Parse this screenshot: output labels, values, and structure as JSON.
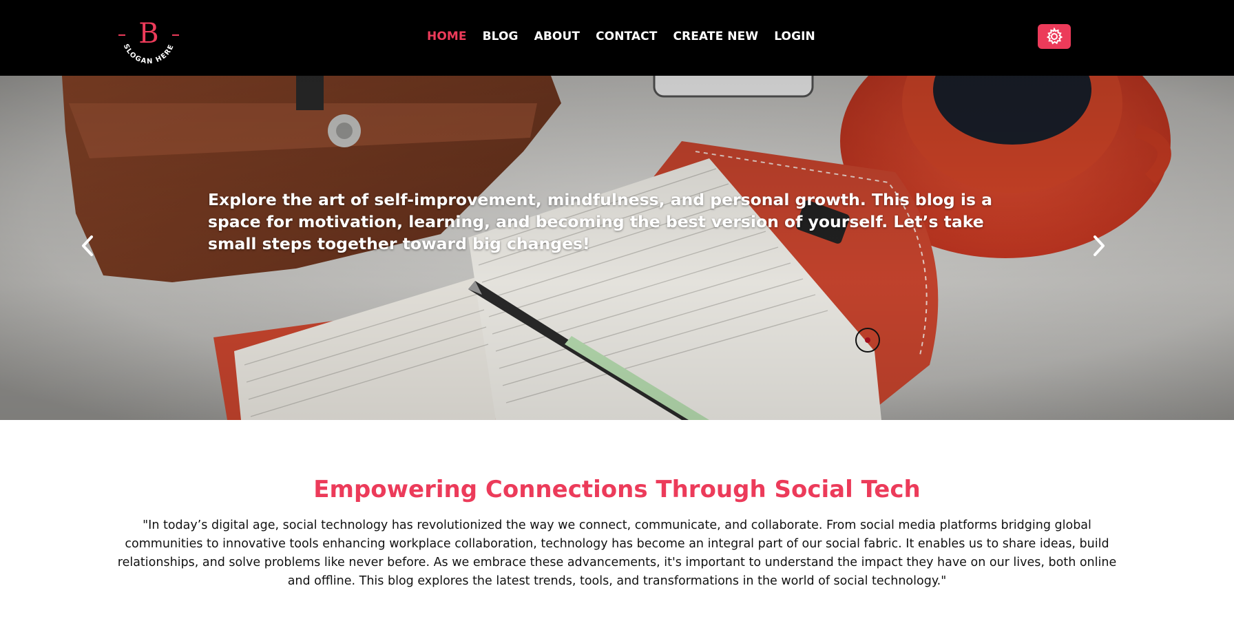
{
  "header": {
    "logo": {
      "letter": "B",
      "slogan": "SLOGAN HERE"
    },
    "nav": [
      {
        "label": "HOME",
        "active": true
      },
      {
        "label": "BLOG",
        "active": false
      },
      {
        "label": "ABOUT",
        "active": false
      },
      {
        "label": "CONTACT",
        "active": false
      },
      {
        "label": "CREATE NEW",
        "active": false
      },
      {
        "label": "LOGIN",
        "active": false
      }
    ],
    "settings_icon": "gear-icon"
  },
  "hero": {
    "text": "Explore the art of self-improvement, mindfulness, and personal growth. This blog is a space for motivation, learning, and becoming the best version of yourself. Let’s take small steps together toward big changes!",
    "prev_icon": "chevron-left-icon",
    "next_icon": "chevron-right-icon"
  },
  "main": {
    "title": "Empowering Connections Through Social Tech",
    "body": "\"In today’s digital age, social technology has revolutionized the way we connect, communicate, and collaborate. From social media platforms bridging global communities to innovative tools enhancing workplace collaboration, technology has become an integral part of our social fabric. It enables us to share ideas, build relationships, and solve problems like never before. As we embrace these advancements, it's important to understand the impact they have on our lives, both online and offline. This blog explores the latest trends, tools, and transformations in the world of social technology.\""
  },
  "colors": {
    "accent": "#ec3b5a",
    "header_bg": "#000000"
  }
}
